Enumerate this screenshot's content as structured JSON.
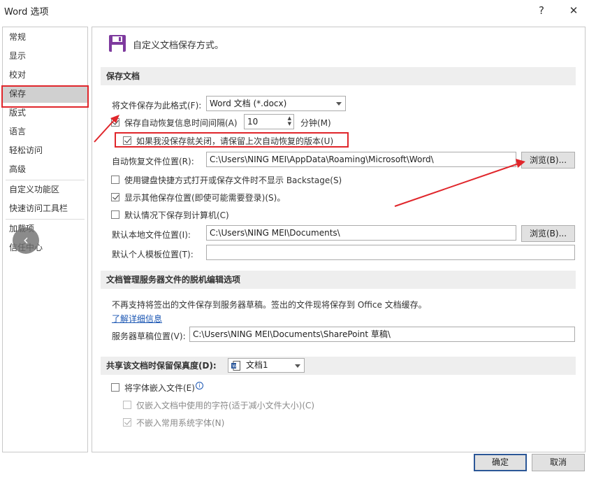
{
  "window": {
    "title": "Word 选项",
    "help_label": "?",
    "close_label": "✕"
  },
  "sidebar": {
    "items": [
      {
        "label": "常规"
      },
      {
        "label": "显示"
      },
      {
        "label": "校对"
      },
      {
        "label": "保存"
      },
      {
        "label": "版式"
      },
      {
        "label": "语言"
      },
      {
        "label": "轻松访问"
      },
      {
        "label": "高级"
      },
      {
        "label": "自定义功能区"
      },
      {
        "label": "快速访问工具栏"
      },
      {
        "label": "加载项"
      },
      {
        "label": "信任中心"
      }
    ],
    "selected": "保存",
    "scroll_left_label": "‹"
  },
  "header": {
    "title": "自定义文档保存方式。",
    "icon": "save-disk-icon"
  },
  "save_docs": {
    "section_title": "保存文档",
    "format_label": "将文件保存为此格式(F):",
    "format_value": "Word 文档 (*.docx)",
    "autorecover_label": "保存自动恢复信息时间间隔(A)",
    "autorecover_checked": true,
    "autorecover_minutes": "10",
    "minutes_label": "分钟(M)",
    "keep_last_label": "如果我没保存就关闭，请保留上次自动恢复的版本(U)",
    "keep_last_checked": true,
    "autorecover_location_label": "自动恢复文件位置(R):",
    "autorecover_location_value": "C:\\Users\\NING MEI\\AppData\\Roaming\\Microsoft\\Word\\",
    "browse_label": "浏览(B)...",
    "no_backstage_label": "使用键盘快捷方式打开或保存文件时不显示 Backstage(S)",
    "no_backstage_checked": false,
    "show_more_locations_label": "显示其他保存位置(即使可能需要登录)(S)。",
    "show_more_locations_checked": true,
    "save_to_computer_label": "默认情况下保存到计算机(C)",
    "save_to_computer_checked": false,
    "default_local_label": "默认本地文件位置(I):",
    "default_local_value": "C:\\Users\\NING MEI\\Documents\\",
    "browse2_label": "浏览(B)...",
    "template_location_label": "默认个人模板位置(T):",
    "template_location_value": ""
  },
  "offline": {
    "section_title": "文档管理服务器文件的脱机编辑选项",
    "info_text": "不再支持将签出的文件保存到服务器草稿。签出的文件现将保存到 Office 文档缓存。",
    "learn_more": "了解详细信息",
    "drafts_label": "服务器草稿位置(V):",
    "drafts_value": "C:\\Users\\NING MEI\\Documents\\SharePoint 草稿\\"
  },
  "fidelity": {
    "section_title": "共享该文档时保留保真度(D):",
    "doc_value": "文档1",
    "embed_fonts_label": "将字体嵌入文件(E)",
    "embed_fonts_checked": false,
    "only_used_label": "仅嵌入文档中使用的字符(适于减小文件大小)(C)",
    "only_used_checked": false,
    "no_common_label": "不嵌入常用系统字体(N)",
    "no_common_checked": true
  },
  "footer": {
    "ok_label": "确定",
    "cancel_label": "取消"
  },
  "colors": {
    "annotation_red": "#e0262b",
    "selected_nav": "#d0d0d0",
    "section_bg": "#eeeeee",
    "link_blue": "#1b56b3",
    "icon_purple": "#7e3a9e"
  }
}
